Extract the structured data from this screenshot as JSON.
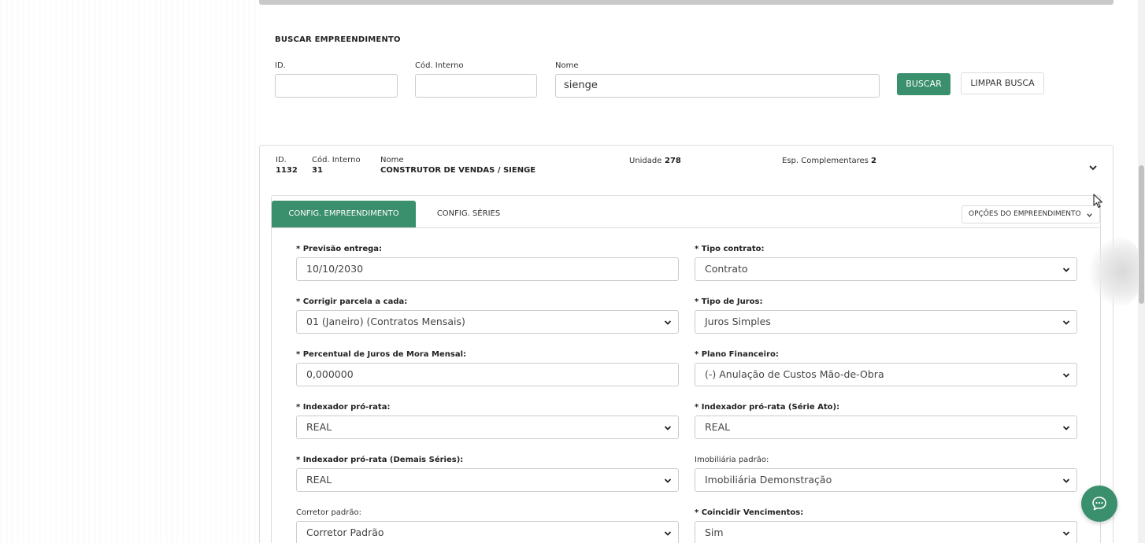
{
  "search": {
    "title": "BUSCAR EMPREENDIMENTO",
    "id_label": "ID.",
    "id_value": "",
    "cod_label": "Cód. Interno",
    "cod_value": "",
    "name_label": "Nome",
    "name_value": "sienge",
    "search_button": "BUSCAR",
    "clear_button": "LIMPAR BUSCA"
  },
  "result": {
    "id_label": "ID.",
    "id_value": "1132",
    "cod_label": "Cód. Interno",
    "cod_value": "31",
    "name_label": "Nome",
    "name_value": "CONSTRUTOR DE VENDAS / SIENGE",
    "unit_label": "Unidade",
    "unit_value": "278",
    "esp_label": "Esp. Complementares",
    "esp_value": "2"
  },
  "tabs": {
    "config_empreendimento": "CONFIG. EMPREENDIMENTO",
    "config_series": "CONFIG. SÉRIES",
    "options": "OPÇÕES DO EMPREENDIMENTO"
  },
  "form": {
    "previsao_label": "* Previsão entrega:",
    "previsao_value": "10/10/2030",
    "tipo_contrato_label": "* Tipo contrato:",
    "tipo_contrato_value": "Contrato",
    "corrigir_label": "* Corrigir parcela a cada:",
    "corrigir_value": "01 (Janeiro) (Contratos Mensais)",
    "tipo_juros_label": "* Tipo de Juros:",
    "tipo_juros_value": "Juros Simples",
    "percentual_label": "* Percentual de Juros de Mora Mensal:",
    "percentual_value": "0,000000",
    "plano_label": "* Plano Financeiro:",
    "plano_value": "(-) Anulação de Custos Mão-de-Obra",
    "indexador_label": "* Indexador pró-rata:",
    "indexador_value": "REAL",
    "indexador_ato_label": "* Indexador pró-rata (Série Ato):",
    "indexador_ato_value": "REAL",
    "indexador_demais_label": "* Indexador pró-rata (Demais Séries):",
    "indexador_demais_value": "REAL",
    "imobiliaria_label": "Imobiliária padrão:",
    "imobiliaria_value": "Imobiliária Demonstração",
    "corretor_label": "Corretor padrão:",
    "corretor_value": "Corretor Padrão",
    "coincidir_label": "* Coincidir Vencimentos:",
    "coincidir_value": "Sim"
  },
  "colors": {
    "primary": "#3a8f6d",
    "border": "#cccccc"
  },
  "icons": [
    "chevron-down-icon",
    "chat-icon",
    "mouse-cursor-icon"
  ]
}
